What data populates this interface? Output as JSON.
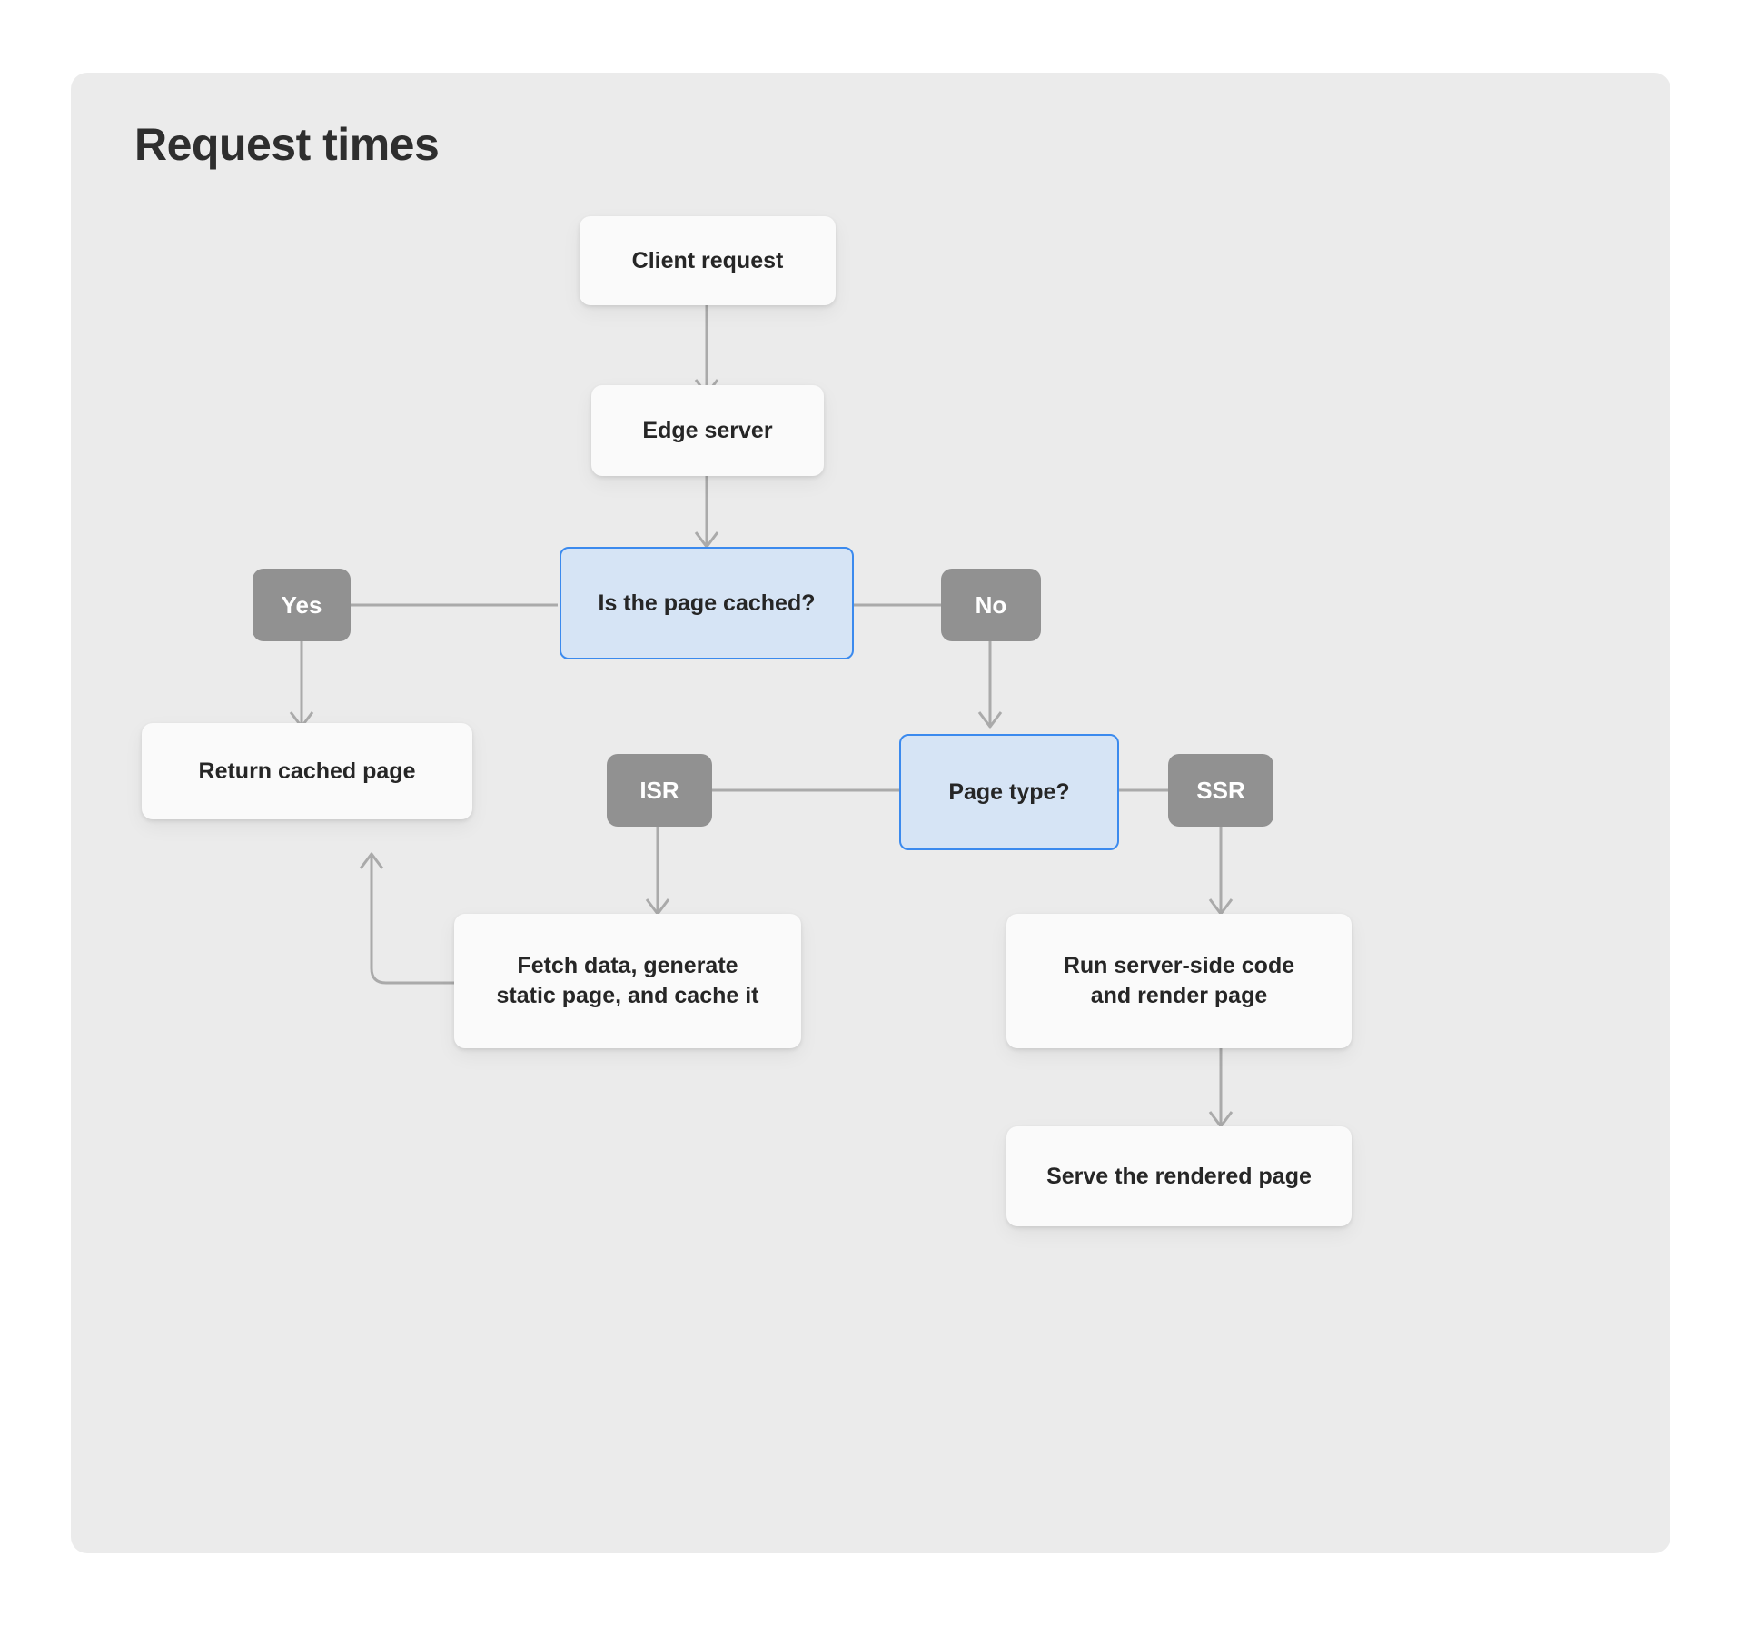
{
  "panel": {
    "title": "Request times",
    "background": "#ebebeb"
  },
  "colors": {
    "page_background": "#ffffff",
    "panel_background": "#ebebeb",
    "node_fill": "#fafafa",
    "node_text": "#262626",
    "decision_fill": "#d6e4f5",
    "decision_border": "#3b8aee",
    "badge_fill": "#919191",
    "badge_text": "#ffffff",
    "connector": "#aaaaaa",
    "title_text": "#2e2e2e"
  },
  "chart_data": {
    "type": "flowchart",
    "title": "Request times",
    "nodes": [
      {
        "id": "client_request",
        "label": "Client request",
        "kind": "process"
      },
      {
        "id": "edge_server",
        "label": "Edge server",
        "kind": "process"
      },
      {
        "id": "is_cached",
        "label": "Is the page cached?",
        "kind": "decision"
      },
      {
        "id": "yes",
        "label": "Yes",
        "kind": "badge"
      },
      {
        "id": "no",
        "label": "No",
        "kind": "badge"
      },
      {
        "id": "return_cached",
        "label": "Return cached page",
        "kind": "process"
      },
      {
        "id": "page_type",
        "label": "Page type?",
        "kind": "decision"
      },
      {
        "id": "isr",
        "label": "ISR",
        "kind": "badge"
      },
      {
        "id": "ssr",
        "label": "SSR",
        "kind": "badge"
      },
      {
        "id": "fetch_generate",
        "label": "Fetch data, generate\nstatic page, and cache it",
        "kind": "process"
      },
      {
        "id": "run_server_side",
        "label": "Run server-side code\nand render page",
        "kind": "process"
      },
      {
        "id": "serve_rendered",
        "label": "Serve the rendered page",
        "kind": "process"
      }
    ],
    "edges": [
      {
        "from": "client_request",
        "to": "edge_server",
        "arrow": true
      },
      {
        "from": "edge_server",
        "to": "is_cached",
        "arrow": true
      },
      {
        "from": "is_cached",
        "to": "yes",
        "arrow": false
      },
      {
        "from": "is_cached",
        "to": "no",
        "arrow": false
      },
      {
        "from": "yes",
        "to": "return_cached",
        "arrow": true
      },
      {
        "from": "no",
        "to": "page_type",
        "arrow": true
      },
      {
        "from": "page_type",
        "to": "isr",
        "arrow": false
      },
      {
        "from": "page_type",
        "to": "ssr",
        "arrow": false
      },
      {
        "from": "isr",
        "to": "fetch_generate",
        "arrow": true
      },
      {
        "from": "ssr",
        "to": "run_server_side",
        "arrow": true
      },
      {
        "from": "run_server_side",
        "to": "serve_rendered",
        "arrow": true
      },
      {
        "from": "fetch_generate",
        "to": "return_cached",
        "arrow": true
      }
    ]
  },
  "nodes": {
    "client_request": {
      "label": "Client request"
    },
    "edge_server": {
      "label": "Edge server"
    },
    "is_cached": {
      "label": "Is the page cached?"
    },
    "yes": {
      "label": "Yes"
    },
    "no": {
      "label": "No"
    },
    "return_cached": {
      "label": "Return cached page"
    },
    "page_type": {
      "label": "Page type?"
    },
    "isr": {
      "label": "ISR"
    },
    "ssr": {
      "label": "SSR"
    },
    "fetch_generate": {
      "line1": "Fetch data, generate",
      "line2": "static page, and cache it"
    },
    "run_server_side": {
      "line1": "Run server-side code",
      "line2": "and render page"
    },
    "serve_rendered": {
      "label": "Serve the rendered page"
    }
  }
}
